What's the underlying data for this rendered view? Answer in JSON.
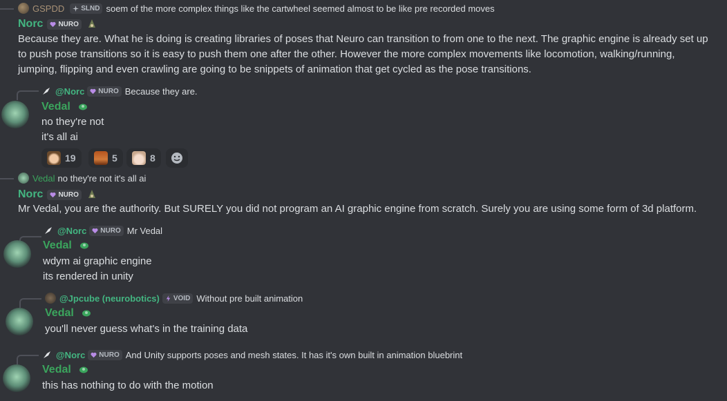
{
  "colors": {
    "background": "#313338",
    "norc": "#43b581",
    "vedal": "#3ba55d",
    "tag_bg": "#3f4147"
  },
  "msg1_reply": {
    "author": "GSPDD",
    "tag": "SLND",
    "text": "soem of the more complex things like the cartwheel seemed almost to be like pre recorded moves"
  },
  "msg1": {
    "author": "Norc",
    "tag": "NURO",
    "lines": [
      "Because they are. What he is doing is creating libraries of poses that Neuro can transition to from one to the next. The graphic engine is already set up",
      "to push pose transitions so it is easy to push them one after the other. However the more complex movements like locomotion, walking/running,",
      "jumping, flipping and even crawling are going to be snippets of animation that get cycled as the pose transitions."
    ]
  },
  "msg2_reply": {
    "mention": "@Norc",
    "tag": "NURO",
    "text": "Because they are."
  },
  "msg2": {
    "author": "Vedal",
    "lines": [
      "no they're not",
      "it's all ai"
    ]
  },
  "reactions": [
    {
      "emoji": "kid-emoji",
      "count": "19"
    },
    {
      "emoji": "face-emoji",
      "count": "5"
    },
    {
      "emoji": "anime-emoji",
      "count": "8"
    }
  ],
  "msg3_reply": {
    "author": "Vedal",
    "text": "no they're not it's all ai"
  },
  "msg3": {
    "author": "Norc",
    "tag": "NURO",
    "text": "Mr Vedal, you are the authority. But SURELY you did not program an AI graphic engine from scratch. Surely you are using some form of 3d platform."
  },
  "msg4_reply": {
    "mention": "@Norc",
    "tag": "NURO",
    "text": "Mr Vedal"
  },
  "msg4": {
    "author": "Vedal",
    "lines": [
      "wdym ai graphic engine",
      "its rendered in unity"
    ]
  },
  "msg5_reply": {
    "mention": "@Jpcube (neurobotics)",
    "tag": "VOID",
    "text": "Without pre built animation"
  },
  "msg5": {
    "author": "Vedal",
    "text": "you'll never guess what's in the training data"
  },
  "msg6_reply": {
    "mention": "@Norc",
    "tag": "NURO",
    "text": "And Unity supports poses and mesh states. It has it's own built in animation bluebrint"
  },
  "msg6": {
    "author": "Vedal",
    "text": "this has nothing to do with the motion"
  }
}
